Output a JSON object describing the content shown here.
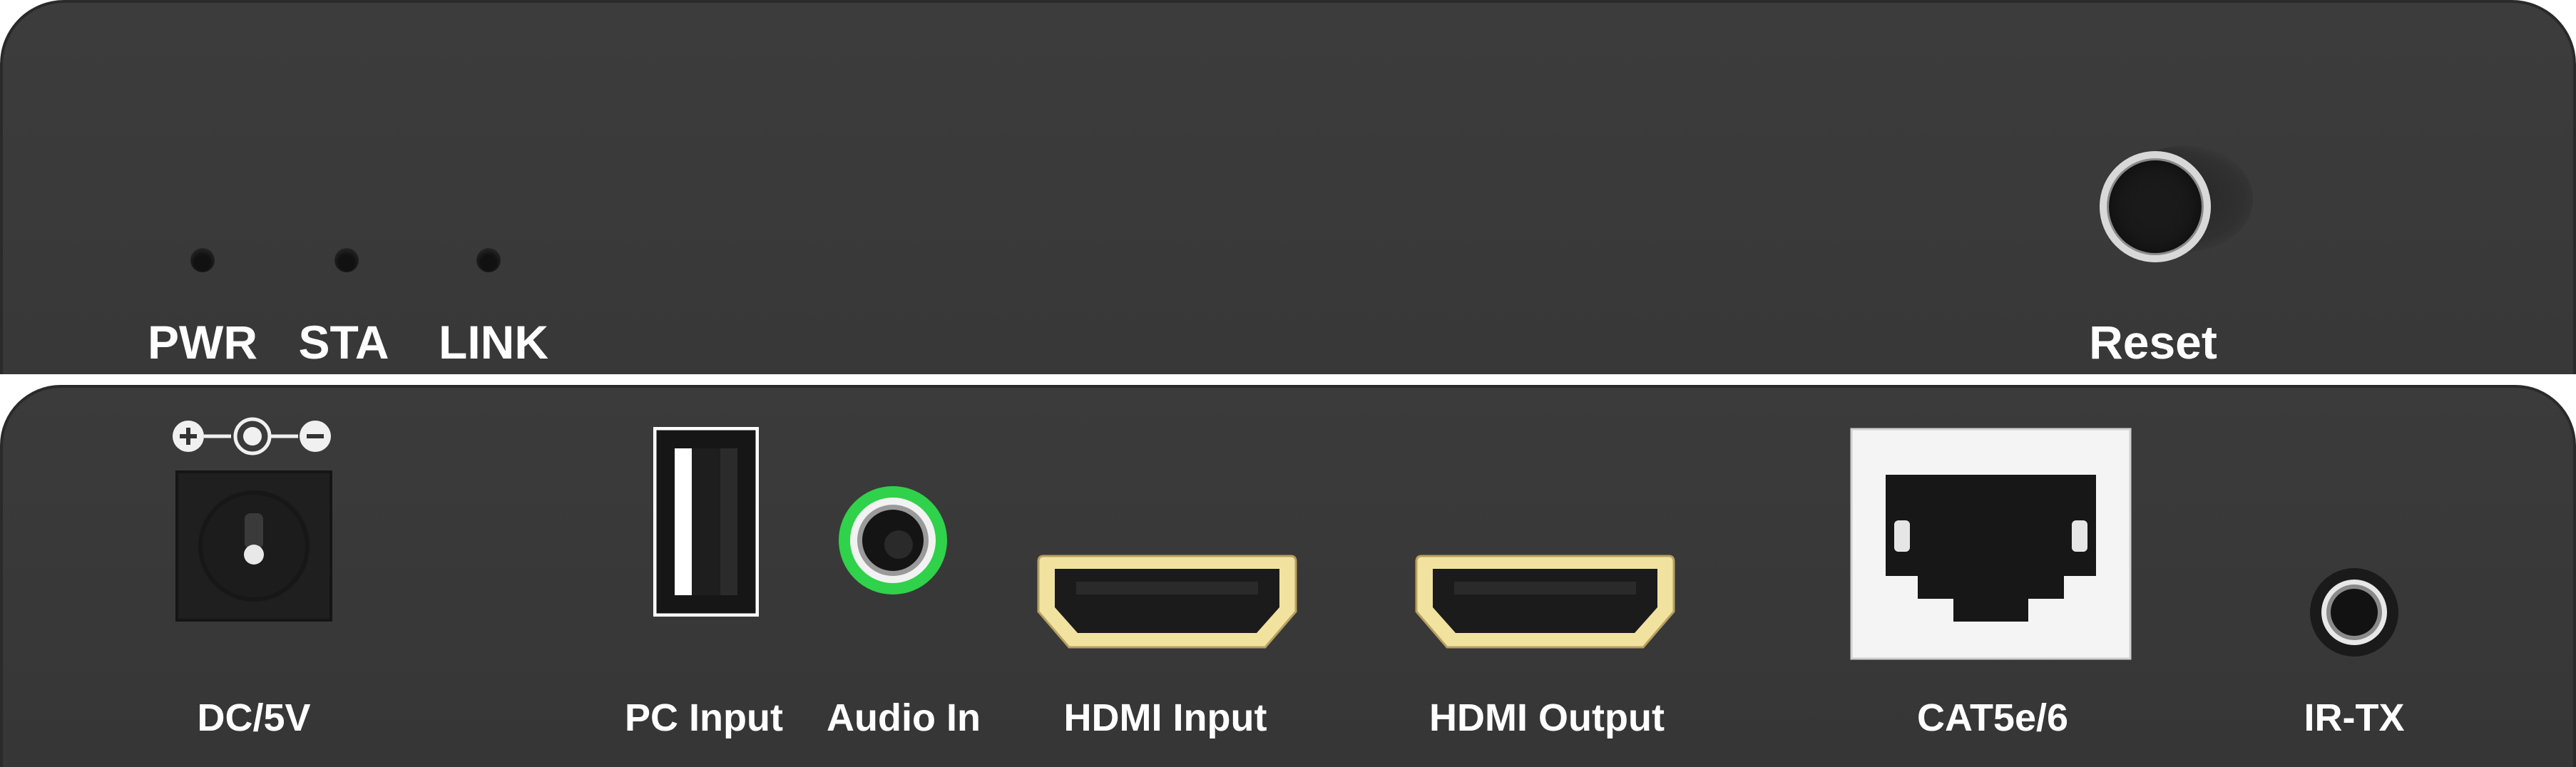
{
  "front_panel": {
    "leds": [
      {
        "label": "PWR"
      },
      {
        "label": "STA"
      },
      {
        "label": "LINK"
      }
    ],
    "reset_label": "Reset"
  },
  "rear_panel": {
    "dc_label": "DC/5V",
    "pc_input_label": "PC Input",
    "audio_in_label": "Audio In",
    "hdmi_input_label": "HDMI Input",
    "hdmi_output_label": "HDMI Output",
    "cat_label": "CAT5e/6",
    "ir_tx_label": "IR-TX"
  },
  "colors": {
    "panel": "#3a3a3a",
    "label": "#ffffff",
    "audio_ring": "#2fd24a",
    "hdmi_gold": "#f2e2a0"
  },
  "icons": [
    "polarity-icon",
    "usb-port-icon",
    "audio-jack-icon",
    "hdmi-port-icon",
    "rj45-port-icon",
    "ir-jack-icon"
  ]
}
